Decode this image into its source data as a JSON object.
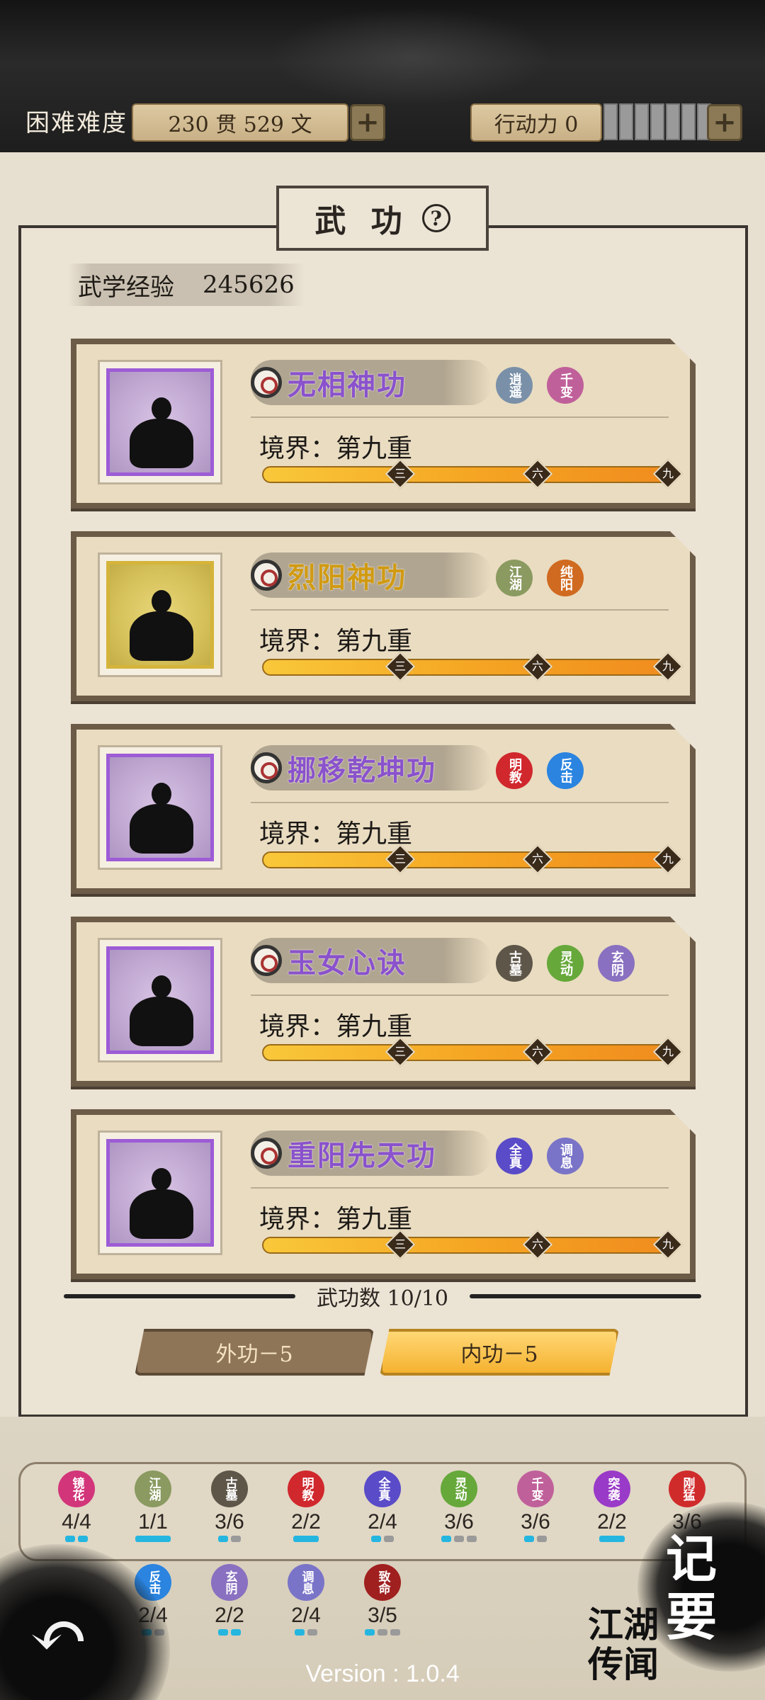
{
  "header": {
    "difficulty_label": "困难难度",
    "money": "230 贯  529  文",
    "action_label": "行动力 0"
  },
  "panel": {
    "title": "武 功",
    "help_glyph": "?",
    "exp_label": "武学经验",
    "exp_value": "245626"
  },
  "skills": [
    {
      "name": "无相神功",
      "realm": "境界：第九重",
      "tags": [
        "逍遥",
        "千变"
      ],
      "progress": 1.0
    },
    {
      "name": "烈阳神功",
      "realm": "境界：第九重",
      "tags": [
        "江湖",
        "纯阳"
      ],
      "progress": 1.0
    },
    {
      "name": "挪移乾坤功",
      "realm": "境界：第九重",
      "tags": [
        "明教",
        "反击"
      ],
      "progress": 1.0
    },
    {
      "name": "玉女心诀",
      "realm": "境界：第九重",
      "tags": [
        "古墓",
        "灵动",
        "玄阴"
      ],
      "progress": 1.0
    },
    {
      "name": "重阳先天功",
      "realm": "境界：第九重",
      "tags": [
        "全真",
        "调息"
      ],
      "progress": 1.0
    }
  ],
  "bar_markers": [
    "三",
    "六",
    "九"
  ],
  "count_text": "武功数 10/10",
  "tabs": {
    "outer": "外功－5",
    "inner": "内功－5"
  },
  "factions": [
    {
      "name": "镜花",
      "count": "4/4",
      "color": "#d2357a"
    },
    {
      "name": "江湖",
      "count": "1/1",
      "color": "#8a9a60"
    },
    {
      "name": "古墓",
      "count": "3/6",
      "color": "#5e5648"
    },
    {
      "name": "明教",
      "count": "2/2",
      "color": "#d0282d"
    },
    {
      "name": "全真",
      "count": "2/4",
      "color": "#5a4bc8"
    },
    {
      "name": "灵动",
      "count": "3/6",
      "color": "#66a83a"
    },
    {
      "name": "千变",
      "count": "3/6",
      "color": "#c0609a"
    },
    {
      "name": "突袭",
      "count": "2/2",
      "color": "#9a3ac8"
    },
    {
      "name": "刚猛",
      "count": "3/6",
      "color": "#d02b2b"
    },
    {
      "name": "反击",
      "count": "2/4",
      "color": "#2a84e0"
    },
    {
      "name": "玄阴",
      "count": "2/2",
      "color": "#8a70c0"
    },
    {
      "name": "调息",
      "count": "2/4",
      "color": "#7a74c8"
    },
    {
      "name": "致命",
      "count": "3/5",
      "color": "#a02020"
    }
  ],
  "side_labels": {
    "memo": "记要",
    "legend": "江湖传闻"
  },
  "version": "Version : 1.0.4",
  "colors": {
    "accent_purple": "#8a52cc",
    "accent_gold": "#d19a12",
    "bar_orange": "#f5a623"
  }
}
